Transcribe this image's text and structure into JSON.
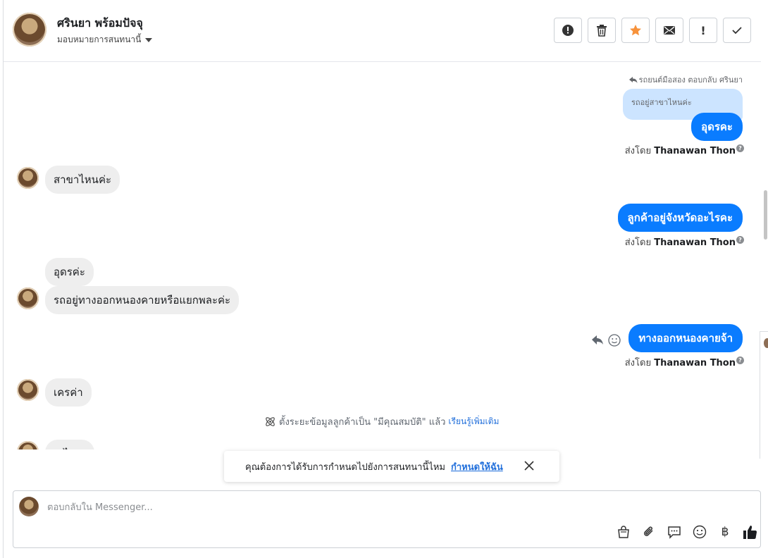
{
  "header": {
    "contact_name": "ศรินยา พร้อมปัจจุ",
    "assign_label": "มอบหมายการสนทนานี้",
    "toolbar": [
      {
        "name": "alert-circle-button",
        "icon": "alert-circle-icon"
      },
      {
        "name": "delete-button",
        "icon": "trash-icon"
      },
      {
        "name": "star-button",
        "icon": "star-icon",
        "color": "#f7923b"
      },
      {
        "name": "mail-button",
        "icon": "mail-icon"
      },
      {
        "name": "important-button",
        "icon": "exclamation-icon",
        "glyph": "!"
      },
      {
        "name": "done-button",
        "icon": "check-icon"
      }
    ]
  },
  "chat": {
    "reply_hint": "รถยนต์มือสอง ตอบกลับ ศรินยา",
    "quoted_text": "รถอยู่สาขาไหนค่ะ",
    "messages": {
      "out_1": "อุดรคะ",
      "in_1": "สาขาไหนค่ะ",
      "out_2": "ลูกค้าอยู่จังหวัดอะไรคะ",
      "in_2": "อุดรค่ะ",
      "in_3": "รถอยู่ทางออกหนองคายหรือแยกพละค่ะ",
      "out_3": "ทางออกหนองคายจ้า",
      "in_4": "เครค่า",
      "in_5_partial": "...ไป..."
    },
    "sent_by_prefix": "ส่งโดย",
    "sent_by_name": "Thanawan Thon",
    "system_note": "ตั้งระยะข้อมูลลูกค้าเป็น \"มีคุณสมบัติ\" แล้ว",
    "system_note_link": "เรียนรู้เพิ่มเติม"
  },
  "toast": {
    "text": "คุณต้องการได้รับการกำหนดไปยังการสนทนานี้ไหม",
    "link": "กำหนดให้ฉัน"
  },
  "composer": {
    "placeholder": "ตอบกลับใน Messenger...",
    "tools": [
      "shopping-bag-icon",
      "paperclip-icon",
      "saved-reply-icon",
      "emoji-icon",
      "baht-icon",
      "thumbs-up-icon"
    ],
    "baht_glyph": "฿"
  },
  "colors": {
    "outgoing_bubble": "#0a7cff",
    "incoming_bubble": "#eeeeee",
    "link": "#216fdb",
    "quoted": "#cce4ff"
  }
}
